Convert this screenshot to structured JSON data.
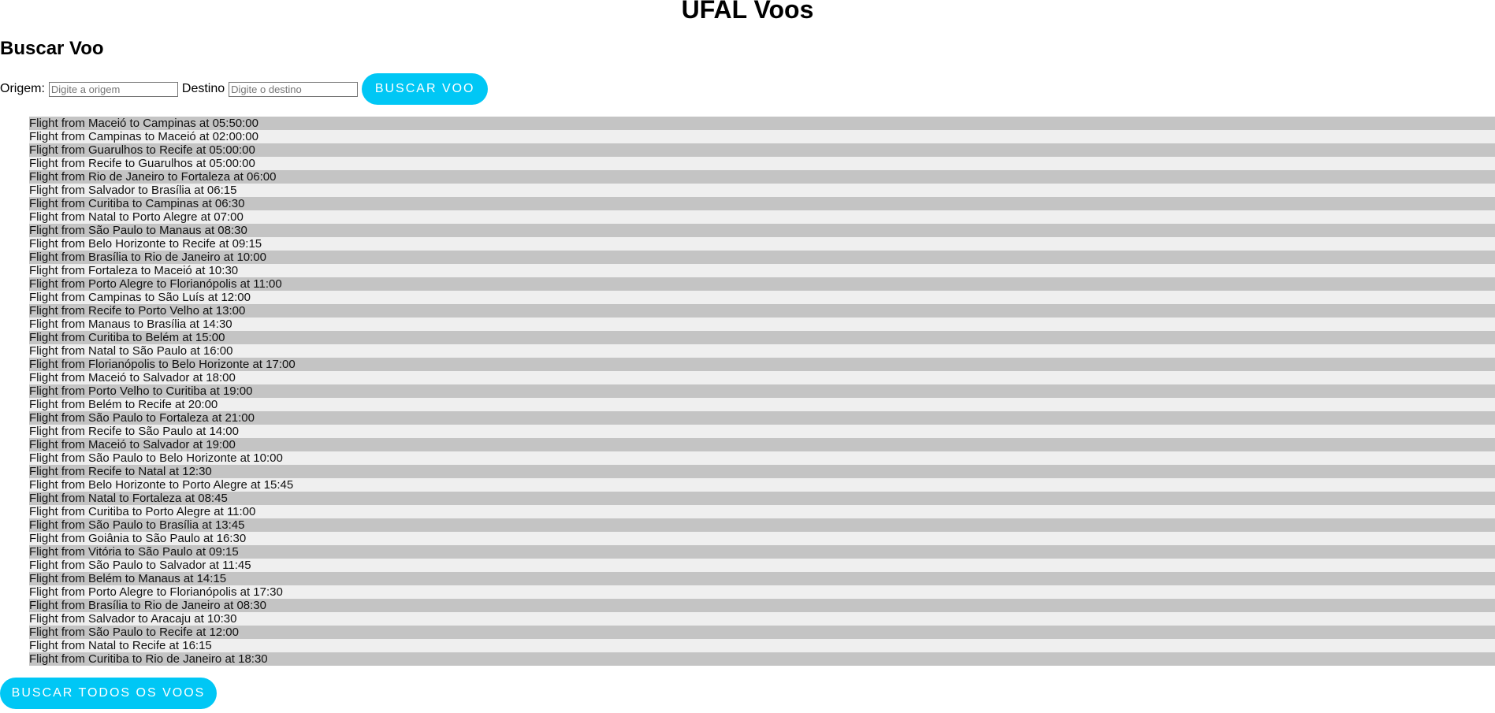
{
  "header": {
    "title": "UFAL Voos"
  },
  "search": {
    "title": "Buscar Voo",
    "origin_label": "Origem:",
    "origin_placeholder": "Digite a origem",
    "destination_label": "Destino",
    "destination_placeholder": "Digite o destino",
    "search_button": "BUSCAR VOO"
  },
  "flights": [
    "Flight from Maceió to Campinas at 05:50:00",
    "Flight from Campinas to Maceió at 02:00:00",
    "Flight from Guarulhos to Recife at 05:00:00",
    "Flight from Recife to Guarulhos at 05:00:00",
    "Flight from Rio de Janeiro to Fortaleza at 06:00",
    "Flight from Salvador to Brasília at 06:15",
    "Flight from Curitiba to Campinas at 06:30",
    "Flight from Natal to Porto Alegre at 07:00",
    "Flight from São Paulo to Manaus at 08:30",
    "Flight from Belo Horizonte to Recife at 09:15",
    "Flight from Brasília to Rio de Janeiro at 10:00",
    "Flight from Fortaleza to Maceió at 10:30",
    "Flight from Porto Alegre to Florianópolis at 11:00",
    "Flight from Campinas to São Luís at 12:00",
    "Flight from Recife to Porto Velho at 13:00",
    "Flight from Manaus to Brasília at 14:30",
    "Flight from Curitiba to Belém at 15:00",
    "Flight from Natal to São Paulo at 16:00",
    "Flight from Florianópolis to Belo Horizonte at 17:00",
    "Flight from Maceió to Salvador at 18:00",
    "Flight from Porto Velho to Curitiba at 19:00",
    "Flight from Belém to Recife at 20:00",
    "Flight from São Paulo to Fortaleza at 21:00",
    "Flight from Recife to São Paulo at 14:00",
    "Flight from Maceió to Salvador at 19:00",
    "Flight from São Paulo to Belo Horizonte at 10:00",
    "Flight from Recife to Natal at 12:30",
    "Flight from Belo Horizonte to Porto Alegre at 15:45",
    "Flight from Natal to Fortaleza at 08:45",
    "Flight from Curitiba to Porto Alegre at 11:00",
    "Flight from São Paulo to Brasília at 13:45",
    "Flight from Goiânia to São Paulo at 16:30",
    "Flight from Vitória to São Paulo at 09:15",
    "Flight from São Paulo to Salvador at 11:45",
    "Flight from Belém to Manaus at 14:15",
    "Flight from Porto Alegre to Florianópolis at 17:30",
    "Flight from Brasília to Rio de Janeiro at 08:30",
    "Flight from Salvador to Aracaju at 10:30",
    "Flight from São Paulo to Recife at 12:00",
    "Flight from Natal to Recife at 16:15",
    "Flight from Curitiba to Rio de Janeiro at 18:30"
  ],
  "footer": {
    "all_flights_button": "BUSCAR TODOS OS VOOS"
  },
  "colors": {
    "accent": "#00c7f5",
    "row_odd": "#c4c4c4",
    "row_even": "#efefef"
  }
}
